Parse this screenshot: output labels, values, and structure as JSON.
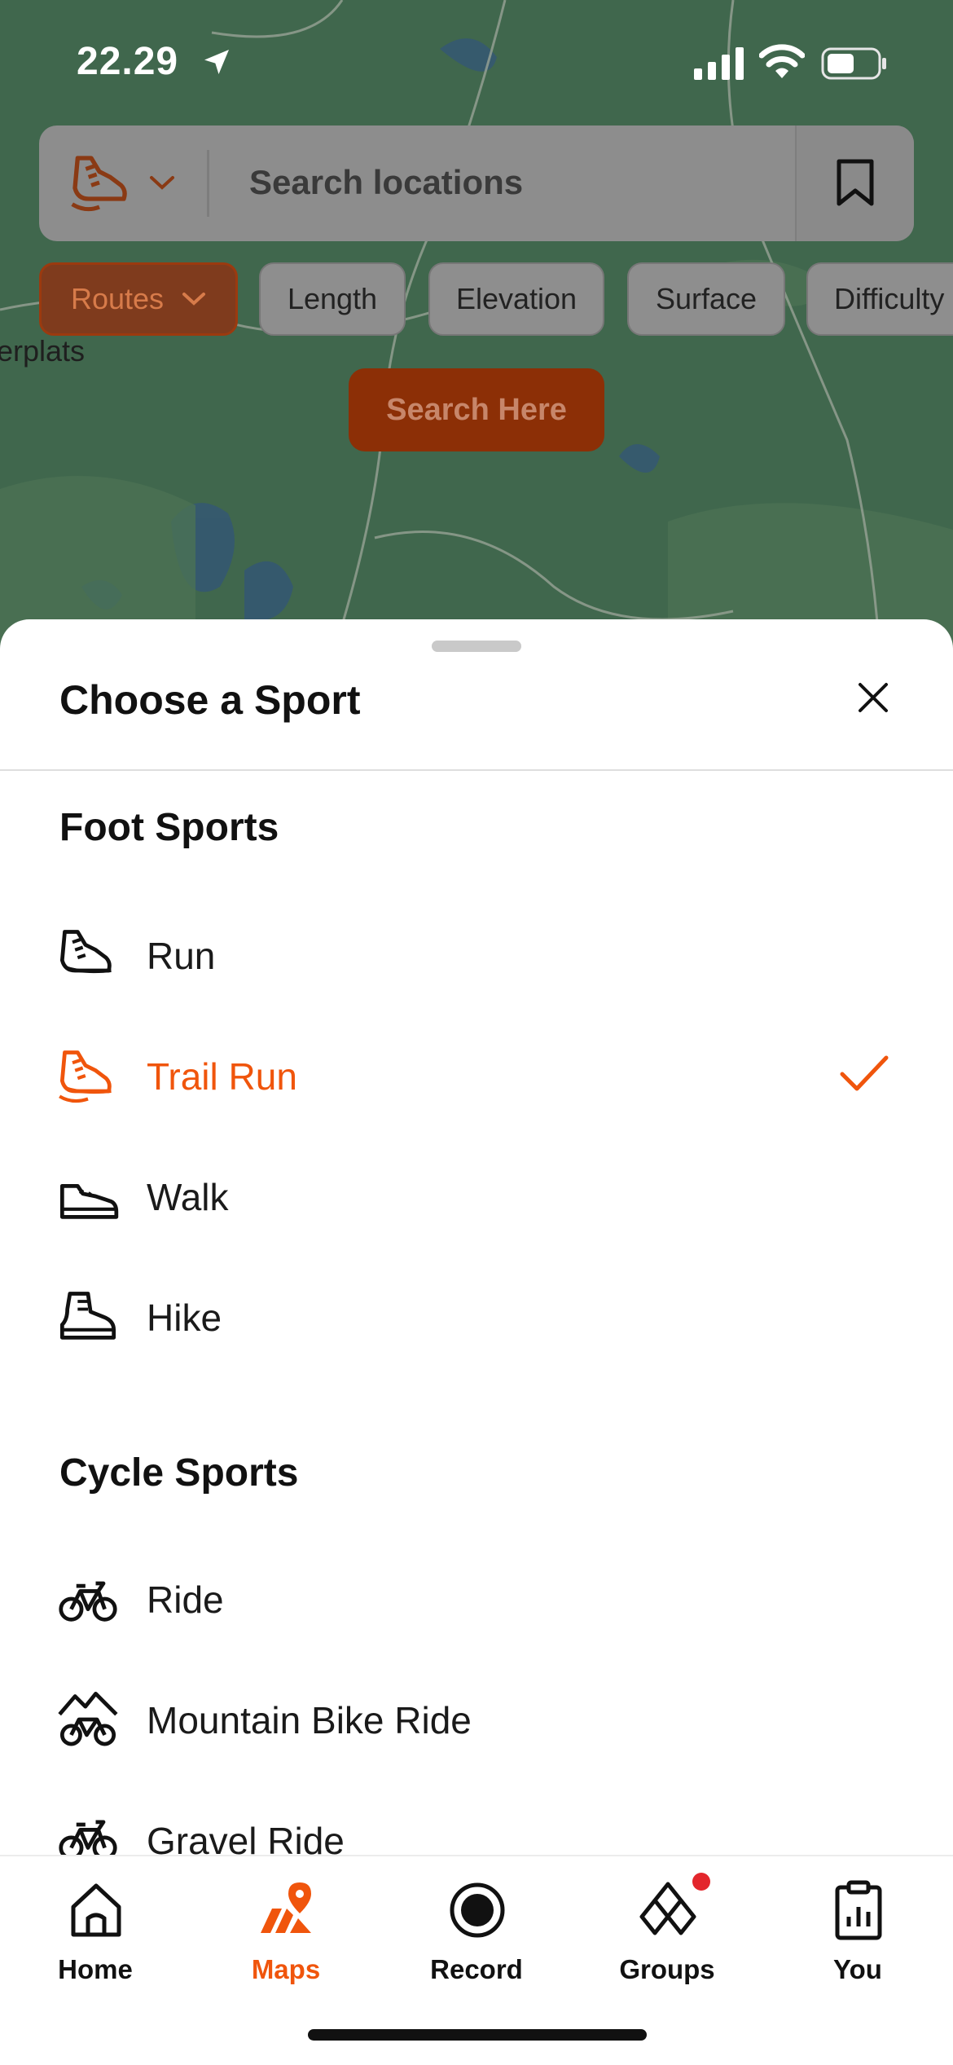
{
  "status_bar": {
    "time": "22.29"
  },
  "search": {
    "placeholder": "Search locations"
  },
  "filters": {
    "chips": [
      "Routes",
      "Length",
      "Elevation",
      "Surface",
      "Difficulty"
    ]
  },
  "map": {
    "label": "erplats",
    "search_here": "Search Here"
  },
  "sheet": {
    "title": "Choose a Sport",
    "sections": [
      {
        "title": "Foot Sports",
        "items": [
          "Run",
          "Trail Run",
          "Walk",
          "Hike"
        ]
      },
      {
        "title": "Cycle Sports",
        "items": [
          "Ride",
          "Mountain Bike Ride",
          "Gravel Ride"
        ]
      }
    ],
    "selected": "Trail Run"
  },
  "tabs": [
    "Home",
    "Maps",
    "Record",
    "Groups",
    "You"
  ],
  "active_tab": "Maps",
  "colors": {
    "accent": "#f0550c",
    "notification": "#e3262c"
  }
}
